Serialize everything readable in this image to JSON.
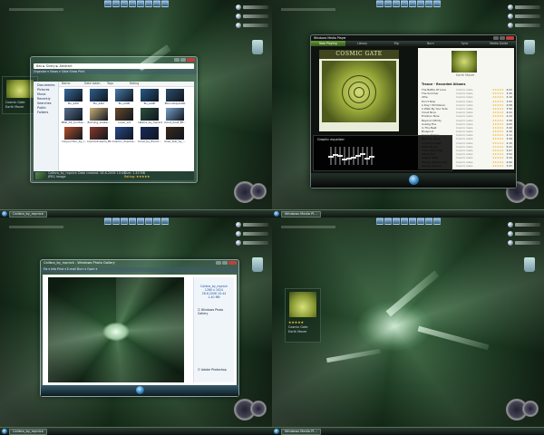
{
  "taskbar": {
    "quad1": [
      "Calibra_by_mpnick"
    ],
    "quad2": [
      "Windows Media Pl..."
    ],
    "quad3": [
      "Calibra_by_mpnick"
    ],
    "quad4": [
      "Windows Media Pl..."
    ]
  },
  "explorer": {
    "title": "",
    "address": "Bas ► Dosty ► Abstract",
    "toolbar": "Organize ▾  Views ▾  Slide Show  Print",
    "nav_items": [
      "Documents",
      "Pictures",
      "Music",
      "Recently",
      "Searches",
      "Public",
      "Folders"
    ],
    "columns": [
      "Name",
      "Date taken",
      "Tags",
      "Rating"
    ],
    "thumbs": [
      {
        "label": "Bu_a2l0",
        "color": "#3a6a9a"
      },
      {
        "label": "Bu_a4l2",
        "color": "#2f5f8a"
      },
      {
        "label": "Bu_a4l4l",
        "color": "#4a7aa8"
      },
      {
        "label": "Bu_a4l4l",
        "color": "#2a5a88"
      },
      {
        "label": "Blurcaleiyes4bl",
        "color": "#2f4d6a"
      },
      {
        "label": "BSD_01_Confus...",
        "color": "#5a6f8c"
      },
      {
        "label": "Burning_Arabe...",
        "color": "#c9b07a"
      },
      {
        "label": "cover_art",
        "color": "#6a4a2a"
      },
      {
        "label": "Calibra_by_mpnick",
        "color": "#2d4f3a"
      },
      {
        "label": "cloud_boat_BT...",
        "color": "#7aa0c8"
      },
      {
        "label": "Conjunction_by_r...",
        "color": "#b2502a"
      },
      {
        "label": "Cosmicdreams_Blu...",
        "color": "#8a3a2a"
      },
      {
        "label": "Cosmic_dreams...",
        "color": "#2a4a8a"
      },
      {
        "label": "Corel_by_Exor2...",
        "color": "#1a2a5a"
      },
      {
        "label": "Crea_Sub_by_...",
        "color": "#3a2a1a"
      }
    ],
    "details_name": "Calibra_by_mpnick  Date created: 28.6.2006 10:44",
    "details_size": "Size: 1.40 MB",
    "details_type": "JPEG Image",
    "details_rating": "Rating: ★★★★★"
  },
  "gadget": {
    "line1": "Cosmic Gate",
    "line2": "Earth Mover",
    "stars": "★★★★★"
  },
  "wmp": {
    "title": "Windows Media Player",
    "tabs": [
      "Now Playing",
      "Library",
      "Rip",
      "Burn",
      "Sync",
      "Media Guide"
    ],
    "album_title": "COSMIC GATE",
    "small_caption": "Earth Mover",
    "list_header": "Trance - Recorded Albums",
    "tracks": [
      {
        "t": "The Battle Of Love",
        "a": "Cosmic Gate",
        "d": "4:02"
      },
      {
        "t": "The Summer",
        "a": "Cosmic Gate",
        "d": "3:45"
      },
      {
        "t": "Afire",
        "a": "Cosmic Gate",
        "d": "4:16"
      },
      {
        "t": "Don't Stop",
        "a": "Cosmic Gate",
        "d": "3:55"
      },
      {
        "t": "A Day I Will Never",
        "a": "Cosmic Gate",
        "d": "4:08"
      },
      {
        "t": "A Walk By Your Side",
        "a": "Cosmic Gate",
        "d": "3:50"
      },
      {
        "t": "Cloud Nine",
        "a": "Cosmic Gate",
        "d": "4:21"
      },
      {
        "t": "Emotion Nine",
        "a": "Cosmic Gate",
        "d": "4:12"
      },
      {
        "t": "Beyond Infinity",
        "a": "Cosmic Gate",
        "d": "3:58"
      },
      {
        "t": "Analog Fire",
        "a": "Cosmic Gate",
        "d": "4:05"
      },
      {
        "t": "In The Beat",
        "a": "Cosmic Gate",
        "d": "3:40"
      },
      {
        "t": "Blueprint",
        "a": "Cosmic Gate",
        "d": "4:30"
      },
      {
        "t": "Grave Digger",
        "a": "Cosmic Gate",
        "d": "4:11"
      },
      {
        "t": "Back On Track",
        "a": "Cosmic Gate",
        "d": "3:49"
      },
      {
        "t": "Consciousness",
        "a": "Cosmic Gate",
        "d": "4:15"
      },
      {
        "t": "Earth Mover",
        "a": "Cosmic Gate",
        "d": "5:01"
      },
      {
        "t": "Think About Me",
        "a": "Cosmic Gate",
        "d": "4:07"
      },
      {
        "t": "Ultraviolet",
        "a": "Cosmic Gate",
        "d": "3:52"
      },
      {
        "t": "Raging Affair",
        "a": "Cosmic Gate",
        "d": "4:24"
      },
      {
        "t": "Should Have Known",
        "a": "Cosmic Gate",
        "d": "4:00"
      },
      {
        "t": "Always Forever",
        "a": "Cosmic Gate",
        "d": "3:47"
      }
    ],
    "rating_glyph": "★★★★★",
    "eq_title": "Graphic equalizer",
    "eq_levels": [
      0.45,
      0.55,
      0.5,
      0.3,
      0.35,
      0.4,
      0.5,
      0.6,
      0.35,
      0.45
    ]
  },
  "ie": {
    "title": "Calibra_by_mpnick - Windows Photo Gallery",
    "toolbar": "Fix ▾  Info  Print ▾  E-mail  Burn ▾  Open ▾",
    "side_links": [
      "Calibra_by_mpnick",
      "1280 x 1024",
      "28.6.2006 10:44",
      "1.40 MB"
    ],
    "check1": "Windows Photo Gallery",
    "check2": "Adobe Photoshop"
  }
}
